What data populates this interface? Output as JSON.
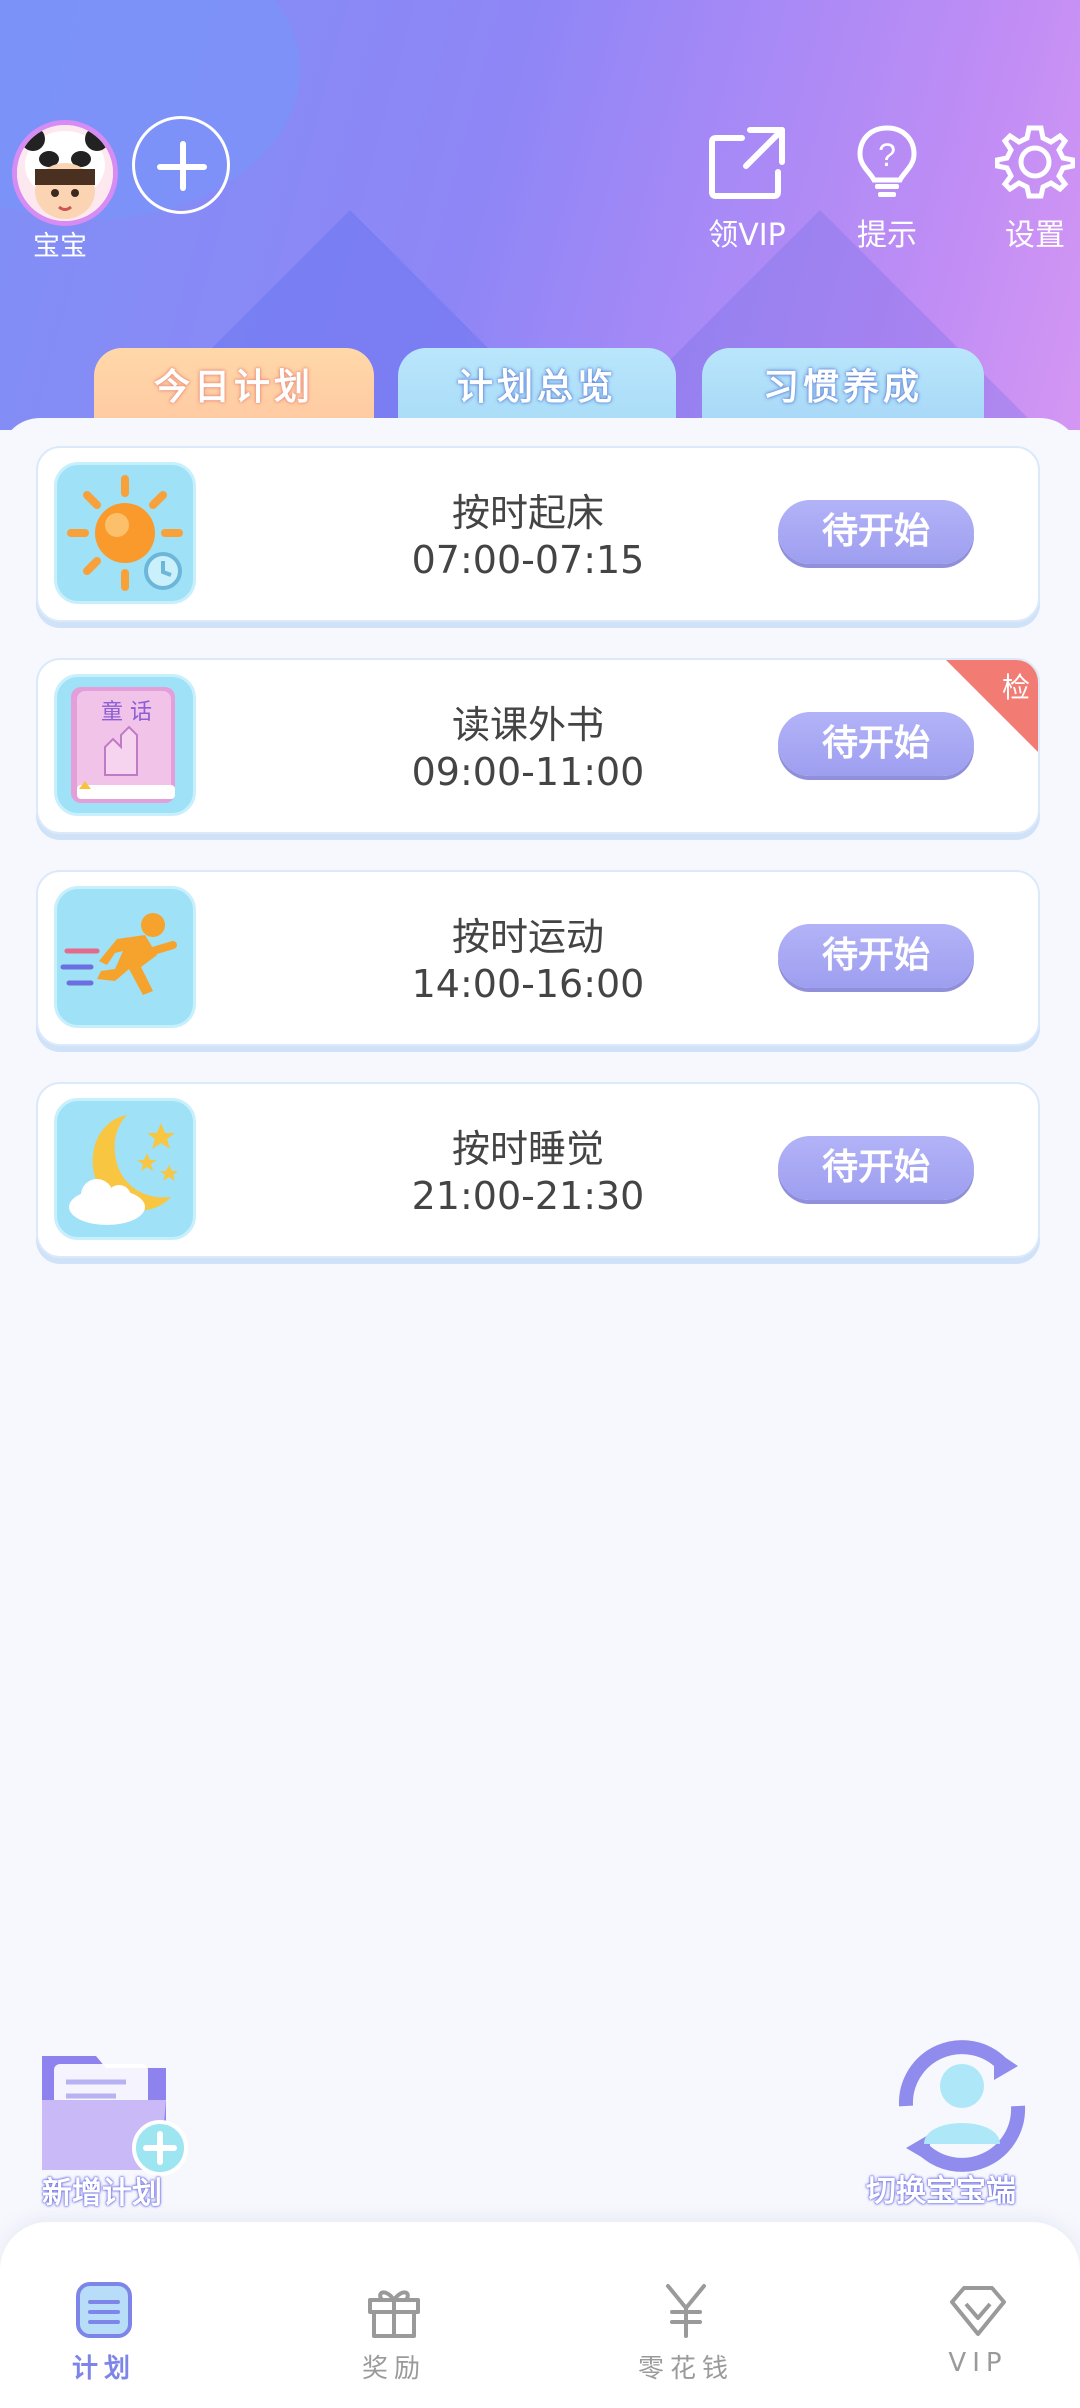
{
  "header": {
    "avatar_label": "宝宝",
    "actions": {
      "vip": "领VIP",
      "tips": "提示",
      "settings": "设置"
    }
  },
  "tabs": [
    "今日计划",
    "计划总览",
    "习惯养成"
  ],
  "tasks": [
    {
      "title": "按时起床",
      "time": "07:00-07:15",
      "status": "待开始",
      "icon": "sun-clock-icon"
    },
    {
      "title": "读课外书",
      "time": "09:00-11:00",
      "status": "待开始",
      "icon": "storybook-icon",
      "badge": "检"
    },
    {
      "title": "按时运动",
      "time": "14:00-16:00",
      "status": "待开始",
      "icon": "running-icon"
    },
    {
      "title": "按时睡觉",
      "time": "21:00-21:30",
      "status": "待开始",
      "icon": "moon-stars-icon"
    }
  ],
  "floating": {
    "add_plan": "新增计划",
    "switch_child": "切换宝宝端"
  },
  "bottom_nav": [
    {
      "label": "计划",
      "icon": "plan-icon",
      "active": true
    },
    {
      "label": "奖励",
      "icon": "gift-icon",
      "active": false
    },
    {
      "label": "零花钱",
      "icon": "yen-icon",
      "active": false
    },
    {
      "label": "VIP",
      "icon": "diamond-icon",
      "active": false
    }
  ],
  "colors": {
    "accent": "#7d86e8",
    "status_button": "#a9a9f4",
    "badge": "#f27c74"
  }
}
